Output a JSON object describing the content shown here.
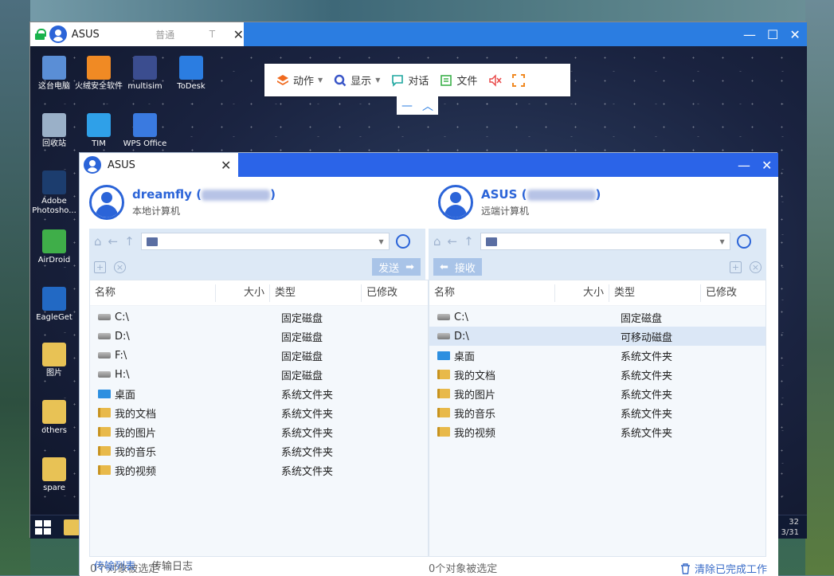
{
  "outer": {
    "title": "ASUS",
    "mode": "普通",
    "t_label": "T"
  },
  "desktop_icons": [
    {
      "label": "这台电脑",
      "color": "#5a8ed6"
    },
    {
      "label": "火绒安全软件",
      "color": "#f08a24"
    },
    {
      "label": "multisim",
      "color": "#3b4d8f"
    },
    {
      "label": "ToDesk",
      "color": "#2b7de1"
    },
    {
      "label": "回收站",
      "color": "#9ab0c8"
    },
    {
      "label": "TIM",
      "color": "#2fa0e8"
    },
    {
      "label": "WPS Office",
      "color": "#3a7ae0"
    },
    {
      "label": "Adobe Photosho...",
      "color": "#1c3d6e"
    },
    {
      "label": "AirDroid",
      "color": "#3fae49"
    },
    {
      "label": "EagleGet",
      "color": "#2269c4"
    },
    {
      "label": "图片",
      "color": "#e8c255"
    },
    {
      "label": "others",
      "color": "#e8c255"
    },
    {
      "label": "spare",
      "color": "#e8c255"
    }
  ],
  "clock": {
    "time": "32",
    "date": "3/31"
  },
  "toolbar": {
    "action": "动作",
    "display": "显示",
    "chat": "对话",
    "file": "文件"
  },
  "ft": {
    "title": "ASUS",
    "local": {
      "name": "dreamfly",
      "paren_open": "(",
      "paren_close": ")",
      "sub": "本地计算机"
    },
    "remote": {
      "name": "ASUS",
      "paren_open": "(",
      "paren_close": ")",
      "sub": "远端计算机"
    },
    "send": "发送",
    "receive": "接收",
    "columns": {
      "name": "名称",
      "size": "大小",
      "type": "类型",
      "modified": "已修改"
    },
    "local_rows": [
      {
        "name": "C:\\",
        "type": "固定磁盘",
        "icon": "drive"
      },
      {
        "name": "D:\\",
        "type": "固定磁盘",
        "icon": "drive"
      },
      {
        "name": "F:\\",
        "type": "固定磁盘",
        "icon": "drive"
      },
      {
        "name": "H:\\",
        "type": "固定磁盘",
        "icon": "drive"
      },
      {
        "name": "桌面",
        "type": "系统文件夹",
        "icon": "desktop"
      },
      {
        "name": "我的文档",
        "type": "系统文件夹",
        "icon": "folder"
      },
      {
        "name": "我的图片",
        "type": "系统文件夹",
        "icon": "folder"
      },
      {
        "name": "我的音乐",
        "type": "系统文件夹",
        "icon": "folder"
      },
      {
        "name": "我的视频",
        "type": "系统文件夹",
        "icon": "folder"
      }
    ],
    "remote_rows": [
      {
        "name": "C:\\",
        "type": "固定磁盘",
        "icon": "drive"
      },
      {
        "name": "D:\\",
        "type": "可移动磁盘",
        "icon": "drive"
      },
      {
        "name": "桌面",
        "type": "系统文件夹",
        "icon": "desktop"
      },
      {
        "name": "我的文档",
        "type": "系统文件夹",
        "icon": "folder"
      },
      {
        "name": "我的图片",
        "type": "系统文件夹",
        "icon": "folder"
      },
      {
        "name": "我的音乐",
        "type": "系统文件夹",
        "icon": "folder"
      },
      {
        "name": "我的视频",
        "type": "系统文件夹",
        "icon": "folder"
      }
    ],
    "local_status": "0个对象被选定",
    "remote_status": "0个对象被选定",
    "tab_transfer_list": "传输列表",
    "tab_transfer_log": "传输日志",
    "clear_done": "清除已完成工作"
  }
}
